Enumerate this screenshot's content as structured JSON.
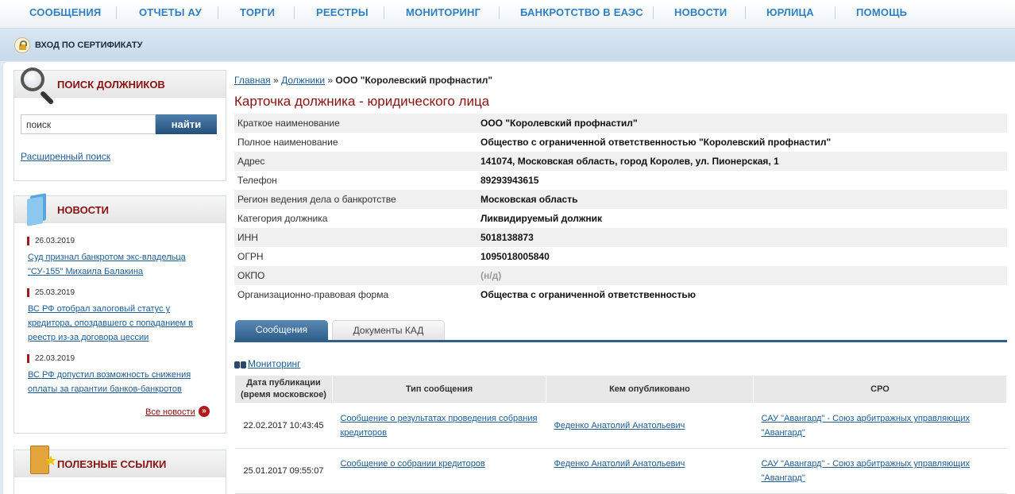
{
  "topnav": {
    "items": [
      "СООБЩЕНИЯ",
      "ОТЧЕТЫ АУ",
      "ТОРГИ",
      "РЕЕСТРЫ",
      "МОНИТОРИНГ",
      "БАНКРОТСТВО В ЕАЭС",
      "НОВОСТИ",
      "ЮРЛИЦА",
      "ПОМОЩЬ"
    ]
  },
  "certbar": {
    "label": "ВХОД ПО СЕРТИФИКАТУ"
  },
  "sidebar": {
    "search": {
      "title": "ПОИСК ДОЛЖНИКОВ",
      "input_value": "поиск",
      "button": "найти",
      "advanced": "Расширенный поиск"
    },
    "news": {
      "title": "НОВОСТИ",
      "items": [
        {
          "date": "26.03.2019",
          "text_line1": "Суд признал банкротом экс-владельца",
          "text_line2": "\"СУ-155\" Михаила Балакина"
        },
        {
          "date": "25.03.2019",
          "text_line1": "ВС РФ отобрал залоговый статус у",
          "text_line2": "кредитора, опоздавшего с попаданием в",
          "text_line3": "реестр из-за договора цессии"
        },
        {
          "date": "22.03.2019",
          "text_line1": "ВС РФ допустил возможность снижения",
          "text_line2": "оплаты за гарантии банков-банкротов"
        }
      ],
      "all_news": "Все новости",
      "all_news_icon": "»"
    },
    "links": {
      "title": "ПОЛЕЗНЫЕ ССЫЛКИ"
    }
  },
  "breadcrumb": {
    "home": "Главная",
    "sep": "»",
    "debtors": "Должники",
    "current": "ООО \"Королевский профнастил\""
  },
  "page_title": "Карточка должника - юридического лица",
  "info": [
    {
      "key": "Краткое наименование",
      "value": "ООО \"Королевский профнастил\""
    },
    {
      "key": "Полное наименование",
      "value": "Общество с ограниченной ответственностью \"Королевский профнастил\""
    },
    {
      "key": "Адрес",
      "value": "141074, Московская область, город Королев, ул. Пионерская, 1"
    },
    {
      "key": "Телефон",
      "value": "89293943615"
    },
    {
      "key": "Регион ведения дела о банкротстве",
      "value": "Московская область"
    },
    {
      "key": "Категория должника",
      "value": "Ликвидируемый должник"
    },
    {
      "key": "ИНН",
      "value": "5018138873"
    },
    {
      "key": "ОГРН",
      "value": "1095018005840"
    },
    {
      "key": "ОКПО",
      "value": "(н/д)"
    },
    {
      "key": "Организационно-правовая форма",
      "value": "Общества с ограниченной ответственностью"
    }
  ],
  "tabs": {
    "active": "Сообщения",
    "inactive": "Документы КАД"
  },
  "monitoring": "Мониторинг",
  "messages": {
    "headers": {
      "date_line1": "Дата публикации",
      "date_line2": "(время московское)",
      "type": "Тип сообщения",
      "author": "Кем опубликовано",
      "sro": "СРО"
    },
    "rows": [
      {
        "date": "22.02.2017 10:43:45",
        "type_line1": "Сообщение о результатах проведения собрания",
        "type_line2": "кредиторов",
        "author": "Феденко Анатолий Анатольевич",
        "sro_line1": "САУ \"Авангард\" - Союз арбитражных управляющих",
        "sro_line2": "\"Авангард\""
      },
      {
        "date": "25.01.2017 09:55:07",
        "type_line1": "Сообщение о собрании кредиторов",
        "type_line2": "",
        "author": "Феденко Анатолий Анатольевич",
        "sro_line1": "САУ \"Авангард\" - Союз арбитражных управляющих",
        "sro_line2": "\"Авангард\""
      }
    ]
  }
}
